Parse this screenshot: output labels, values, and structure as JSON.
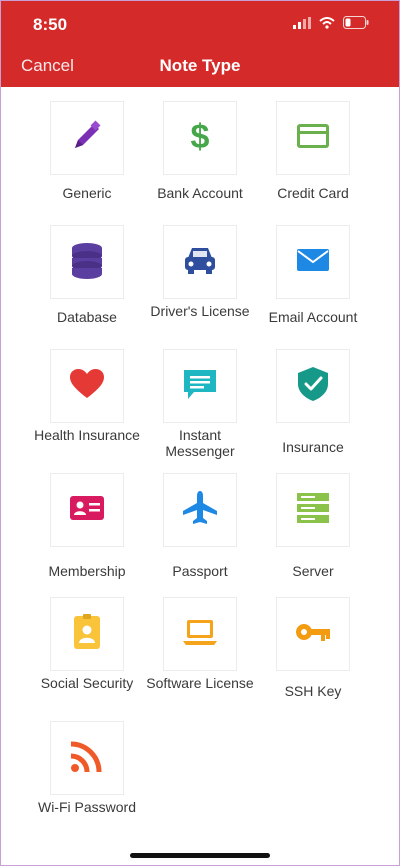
{
  "status_bar": {
    "time": "8:50"
  },
  "nav": {
    "cancel_label": "Cancel",
    "title": "Note Type"
  },
  "colors": {
    "header": "#d42a2a",
    "generic": "#7b2fb5",
    "bank": "#46a64a",
    "credit": "#6ab04c",
    "database": "#5b3fa0",
    "driver": "#2f4f9e",
    "email": "#1e88e5",
    "health": "#e53935",
    "messenger": "#1fb6c3",
    "insurance": "#17998a",
    "membership": "#d81b60",
    "passport": "#1e88e5",
    "server": "#8bc34a",
    "social": "#f9c33a",
    "software": "#f5a31a",
    "ssh": "#f39c12",
    "wifi": "#f05a28"
  },
  "note_types": [
    {
      "label": "Generic",
      "icon": "pencil-icon"
    },
    {
      "label": "Bank Account",
      "icon": "dollar-icon"
    },
    {
      "label": "Credit Card",
      "icon": "credit-card-icon"
    },
    {
      "label": "Database",
      "icon": "database-icon"
    },
    {
      "label": "Driver's License",
      "icon": "car-icon"
    },
    {
      "label": "Email Account",
      "icon": "envelope-icon"
    },
    {
      "label": "Health Insurance",
      "icon": "heart-icon"
    },
    {
      "label": "Instant Messenger",
      "icon": "chat-bubble-icon"
    },
    {
      "label": "Insurance",
      "icon": "shield-check-icon"
    },
    {
      "label": "Membership",
      "icon": "id-card-icon"
    },
    {
      "label": "Passport",
      "icon": "airplane-icon"
    },
    {
      "label": "Server",
      "icon": "server-icon"
    },
    {
      "label": "Social Security",
      "icon": "badge-person-icon"
    },
    {
      "label": "Software License",
      "icon": "laptop-icon"
    },
    {
      "label": "SSH Key",
      "icon": "key-icon"
    },
    {
      "label": "Wi-Fi Password",
      "icon": "rss-icon"
    }
  ]
}
